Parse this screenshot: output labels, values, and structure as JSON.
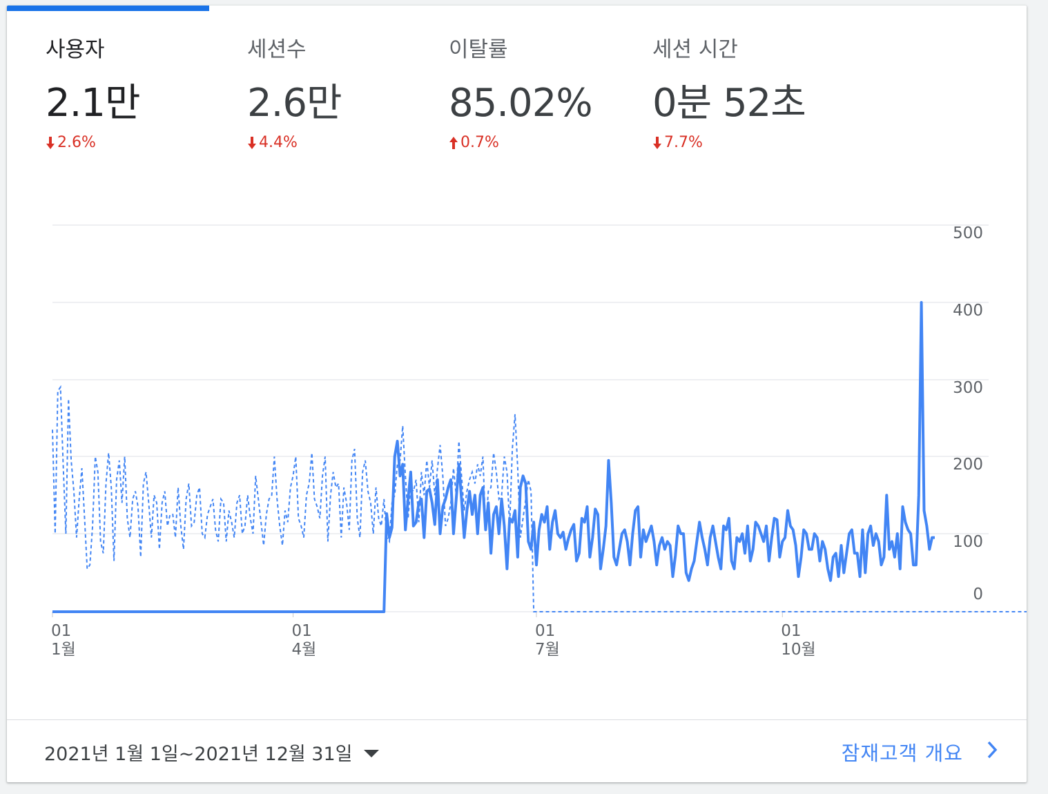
{
  "metrics": [
    {
      "label": "사용자",
      "value": "2.1만",
      "delta": "2.6%",
      "direction": "down"
    },
    {
      "label": "세션수",
      "value": "2.6만",
      "delta": "4.4%",
      "direction": "down"
    },
    {
      "label": "이탈률",
      "value": "85.02%",
      "delta": "0.7%",
      "direction": "up"
    },
    {
      "label": "세션 시간",
      "value": "0분 52초",
      "delta": "7.7%",
      "direction": "down"
    }
  ],
  "footer": {
    "date_range": "2021년 1월 1일~2021년 12월 31일",
    "audience_link": "잠재고객 개요"
  },
  "colors": {
    "accent": "#1a73e8",
    "series": "#4285f4",
    "negative": "#d93025",
    "link": "#4285f4"
  },
  "chart_data": {
    "type": "line",
    "y_ticks": [
      0,
      100,
      200,
      300,
      400,
      500
    ],
    "ylim": [
      0,
      500
    ],
    "x_ticks": [
      {
        "day": 0,
        "day_label": "01",
        "month_label": "1월"
      },
      {
        "day": 90,
        "day_label": "01",
        "month_label": "4월"
      },
      {
        "day": 181,
        "day_label": "01",
        "month_label": "7월"
      },
      {
        "day": 273,
        "day_label": "01",
        "month_label": "10월"
      }
    ],
    "grid": true,
    "series": [
      {
        "style": "solid",
        "note": "current period (approximate daily values)",
        "values": [
          0,
          0,
          0,
          0,
          0,
          0,
          0,
          0,
          0,
          0,
          0,
          0,
          0,
          0,
          0,
          0,
          0,
          0,
          0,
          0,
          0,
          0,
          0,
          0,
          0,
          0,
          0,
          0,
          0,
          0,
          0,
          0,
          0,
          0,
          0,
          0,
          0,
          0,
          0,
          0,
          0,
          0,
          0,
          0,
          0,
          0,
          0,
          0,
          0,
          0,
          0,
          0,
          0,
          0,
          0,
          0,
          0,
          0,
          0,
          0,
          0,
          0,
          0,
          0,
          0,
          0,
          0,
          0,
          0,
          0,
          0,
          0,
          0,
          0,
          0,
          0,
          0,
          0,
          0,
          0,
          0,
          0,
          0,
          0,
          0,
          0,
          0,
          0,
          0,
          0,
          0,
          0,
          0,
          0,
          0,
          0,
          0,
          0,
          0,
          0,
          0,
          0,
          0,
          0,
          0,
          0,
          0,
          0,
          0,
          0,
          0,
          0,
          0,
          0,
          0,
          0,
          0,
          0,
          0,
          0,
          0,
          0,
          0,
          0,
          0,
          126,
          95,
          108,
          200,
          220,
          175,
          190,
          105,
          145,
          180,
          110,
          115,
          140,
          145,
          95,
          155,
          158,
          140,
          112,
          170,
          100,
          135,
          145,
          160,
          170,
          100,
          145,
          190,
          145,
          95,
          130,
          155,
          125,
          150,
          100,
          150,
          160,
          105,
          140,
          75,
          125,
          135,
          100,
          145,
          110,
          55,
          120,
          115,
          130,
          70,
          160,
          175,
          165,
          90,
          80,
          115,
          60,
          105,
          125,
          115,
          135,
          80,
          115,
          130,
          100,
          95,
          102,
          80,
          94,
          105,
          112,
          65,
          75,
          120,
          115,
          135,
          70,
          95,
          132,
          125,
          55,
          80,
          110,
          195,
          140,
          70,
          60,
          80,
          100,
          105,
          90,
          60,
          100,
          130,
          135,
          70,
          105,
          90,
          100,
          110,
          90,
          60,
          85,
          95,
          80,
          90,
          85,
          45,
          72,
          110,
          100,
          100,
          50,
          40,
          55,
          65,
          90,
          115,
          95,
          80,
          60,
          95,
          110,
          90,
          70,
          55,
          110,
          105,
          120,
          65,
          55,
          95,
          90,
          100,
          75,
          110,
          65,
          80,
          115,
          110,
          100,
          90,
          110,
          65,
          95,
          120,
          118,
          70,
          90,
          95,
          130,
          110,
          105,
          85,
          45,
          70,
          105,
          100,
          80,
          80,
          100,
          95,
          65,
          90,
          80,
          55,
          40,
          70,
          75,
          45,
          85,
          50,
          75,
          100,
          105,
          75,
          75,
          45,
          105,
          50,
          100,
          110,
          85,
          100,
          90,
          60,
          70,
          150,
          80,
          90,
          70,
          100,
          55,
          135,
          115,
          105,
          100,
          60,
          60,
          150,
          400,
          130,
          110,
          80,
          95,
          95
        ]
      },
      {
        "style": "dashed",
        "note": "previous period (approximate daily values)",
        "values": [
          235,
          100,
          285,
          290,
          190,
          100,
          275,
          195,
          155,
          95,
          145,
          185,
          120,
          55,
          60,
          110,
          200,
          180,
          90,
          75,
          165,
          205,
          160,
          65,
          170,
          195,
          140,
          200,
          120,
          95,
          145,
          155,
          135,
          70,
          165,
          180,
          140,
          95,
          150,
          140,
          80,
          140,
          155,
          110,
          125,
          125,
          95,
          160,
          110,
          80,
          145,
          165,
          110,
          115,
          150,
          160,
          100,
          95,
          125,
          135,
          145,
          105,
          90,
          145,
          140,
          90,
          130,
          115,
          95,
          140,
          150,
          100,
          110,
          150,
          120,
          100,
          175,
          145,
          115,
          85,
          125,
          145,
          150,
          200,
          145,
          110,
          85,
          130,
          115,
          160,
          175,
          200,
          120,
          110,
          95,
          150,
          165,
          205,
          145,
          135,
          120,
          175,
          200,
          90,
          150,
          180,
          160,
          165,
          95,
          160,
          140,
          105,
          195,
          210,
          120,
          95,
          180,
          195,
          155,
          140,
          100,
          160,
          120,
          110,
          145,
          95,
          90,
          140,
          150,
          190,
          195,
          240,
          175,
          120,
          160,
          155,
          170,
          115,
          180,
          150,
          195,
          160,
          195,
          150,
          185,
          215,
          175,
          110,
          120,
          140,
          185,
          150,
          220,
          175,
          130,
          155,
          170,
          180,
          165,
          190,
          175,
          200,
          105,
          155,
          160,
          205,
          180,
          145,
          150,
          200,
          180,
          110,
          210,
          255,
          185,
          95,
          120,
          145,
          170,
          155,
          0,
          0,
          0,
          0,
          0,
          0,
          0,
          0,
          0,
          0,
          0,
          0,
          0,
          0,
          0,
          0,
          0,
          0,
          0,
          0,
          0,
          0,
          0,
          0,
          0,
          0,
          0,
          0,
          0,
          0,
          0,
          0,
          0,
          0,
          0,
          0,
          0,
          0,
          0,
          0,
          0,
          0,
          0,
          0,
          0,
          0,
          0,
          0,
          0,
          0,
          0,
          0,
          0,
          0,
          0,
          0,
          0,
          0,
          0,
          0,
          0,
          0,
          0,
          0,
          0,
          0,
          0,
          0,
          0,
          0,
          0,
          0,
          0,
          0,
          0,
          0,
          0,
          0,
          0,
          0,
          0,
          0,
          0,
          0,
          0,
          0,
          0,
          0,
          0,
          0,
          0,
          0,
          0,
          0,
          0,
          0,
          0,
          0,
          0,
          0,
          0,
          0,
          0,
          0,
          0,
          0,
          0,
          0,
          0,
          0,
          0,
          0,
          0,
          0,
          0,
          0,
          0,
          0,
          0,
          0,
          0,
          0,
          0,
          0,
          0,
          0,
          0,
          0,
          0,
          0,
          0,
          0,
          0,
          0,
          0,
          0,
          0,
          0,
          0,
          0,
          0,
          0,
          0,
          0,
          0,
          0,
          0,
          0,
          0,
          0,
          0,
          0,
          0,
          0,
          0,
          0,
          0,
          0,
          0,
          0,
          0,
          0,
          0,
          0,
          0,
          0,
          0,
          0,
          0,
          0,
          0,
          0,
          0,
          0,
          0,
          0,
          0,
          0,
          0,
          0,
          0,
          0,
          0,
          0,
          0,
          0,
          0,
          0,
          0,
          0,
          0,
          0,
          0,
          0,
          0,
          0,
          0,
          0,
          0,
          0,
          0,
          0,
          0,
          0,
          0,
          0
        ]
      }
    ]
  }
}
